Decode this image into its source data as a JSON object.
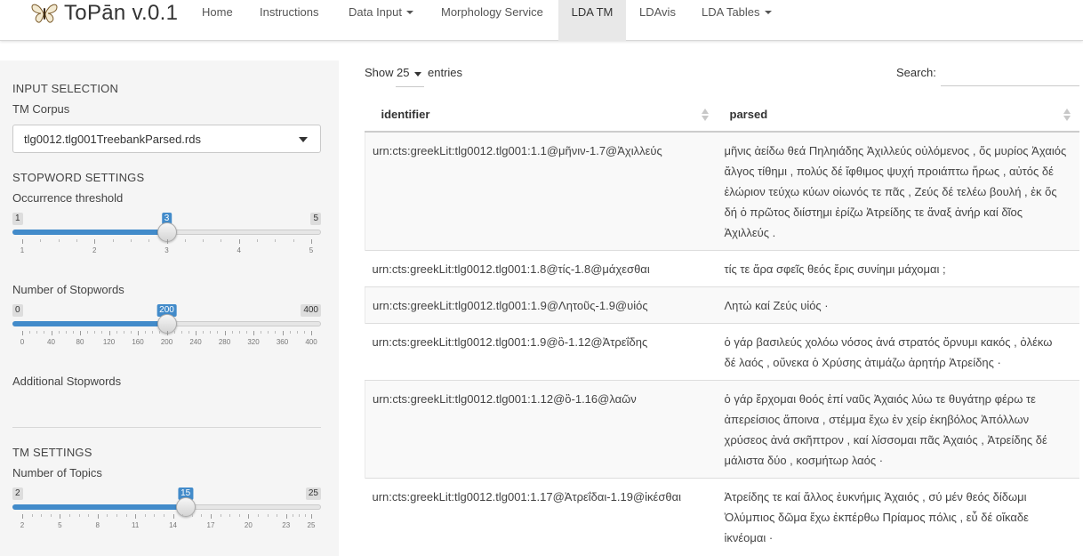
{
  "navbar": {
    "brand": "ToPān v.0.1",
    "items": [
      {
        "label": "Home"
      },
      {
        "label": "Instructions"
      },
      {
        "label": "Data Input"
      },
      {
        "label": "Morphology Service"
      },
      {
        "label": "LDA TM"
      },
      {
        "label": "LDAvis"
      },
      {
        "label": "LDA Tables"
      }
    ],
    "active_tab": "LDA TM",
    "active_color": "#e8e8e8"
  },
  "sidebar": {
    "input_section": "INPUT SELECTION",
    "corpus_label": "TM Corpus",
    "corpus_value": "tlg0012.tlg001TreebankParsed.rds",
    "stopword_section": "STOPWORD SETTINGS",
    "occurrence": {
      "label": "Occurrence threshold",
      "min": "1",
      "max": "5",
      "value": "3",
      "ticks": [
        "1",
        "2",
        "3",
        "4",
        "5"
      ],
      "fraction": 0.5
    },
    "stopwords": {
      "label": "Number of Stopwords",
      "min": "0",
      "max": "400",
      "value": "200",
      "ticks": [
        "0",
        "40",
        "80",
        "120",
        "160",
        "200",
        "240",
        "280",
        "320",
        "360",
        "400"
      ],
      "fraction": 0.5
    },
    "additional_label": "Additional Stopwords",
    "tm_section": "TM SETTINGS",
    "topics": {
      "label": "Number of Topics",
      "min": "2",
      "max": "25",
      "value": "15",
      "ticks": [
        "2",
        "5",
        "8",
        "11",
        "14",
        "17",
        "20",
        "23",
        "25"
      ],
      "fraction": 0.565
    },
    "accent_color": "#428bca"
  },
  "table_controls": {
    "show_label": "Show",
    "entries_value": "25",
    "entries_label": "entries",
    "search_label": "Search:"
  },
  "table": {
    "columns": [
      "identifier",
      "parsed"
    ],
    "rows": [
      {
        "identifier": "urn:cts:greekLit:tlg0012.tlg001:1.1@μῆνιν-1.7@Ἀχιλλεύς",
        "parsed": "μῆνις ἀείδω θεά Πηληιάδης Ἀχιλλεύς οὐλόμενος , ὅς μυρίος Ἀχαιός ἄλγος τίθημι , πολύς δέ ἴφθιμος ψυχή προιάπτω ἥρως , αὐτός δέ ἑλώριον τεύχω κύων οἰωνός τε πᾶς , Ζεύς δέ τελέω βουλή , ἐκ ὅς δή ὁ πρῶτος διίστημι ἐρίζω Ἀτρείδης τε ἄναξ ἀνήρ καί δῖος Ἀχιλλεύς ."
      },
      {
        "identifier": "urn:cts:greekLit:tlg0012.tlg001:1.8@τίς-1.8@μάχεσθαι",
        "parsed": "τίς τε ἄρα σφεῖς θεός ἔρις συνίημι μάχομαι ;"
      },
      {
        "identifier": "urn:cts:greekLit:tlg0012.tlg001:1.9@Λητοῦς-1.9@υἱός",
        "parsed": "Λητώ καί Ζεύς υἱός ·"
      },
      {
        "identifier": "urn:cts:greekLit:tlg0012.tlg001:1.9@ὃ-1.12@Ἀτρεΐδης",
        "parsed": "ὁ γάρ βασιλεύς χολόω νόσος ἀνά στρατός ὄρνυμι κακός , ὀλέκω δέ λαός , οὕνεκα ὁ Χρύσης ἀτιμάζω ἀρητήρ Ἀτρείδης ·"
      },
      {
        "identifier": "urn:cts:greekLit:tlg0012.tlg001:1.12@ὃ-1.16@λαῶν",
        "parsed": "ὁ γάρ ἔρχομαι θοός ἐπί ναῦς Ἀχαιός λύω τε θυγάτηρ φέρω τε ἀπερείσιος ἄποινα , στέμμα ἔχω ἐν χείρ ἑκηβόλος Ἀπόλλων χρύσεος ἀνά σκῆπτρον , καί λίσσομαι πᾶς Ἀχαιός , Ἀτρείδης δέ μάλιστα δύο , κοσμήτωρ λαός ·"
      },
      {
        "identifier": "urn:cts:greekLit:tlg0012.tlg001:1.17@Ἀτρεΐδαι-1.19@ἱκέσθαι",
        "parsed": "Ἀτρείδης τε καί ἄλλος ἐυκνήμις Ἀχαιός , σύ μέν θεός δίδωμι Ὀλύμπιος δῶμα ἔχω ἐκπέρθω Πρίαμος πόλις , εὖ δέ οἴκαδε ἱκνέομαι ·"
      }
    ]
  }
}
